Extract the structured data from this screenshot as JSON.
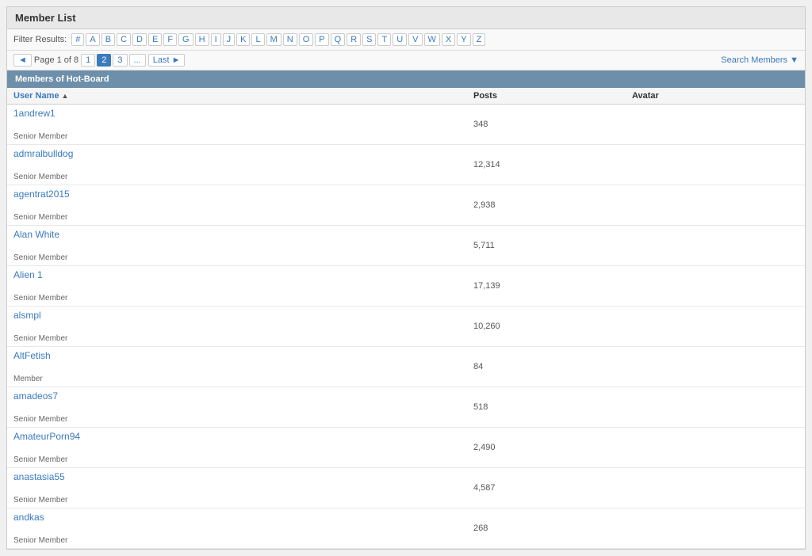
{
  "page": {
    "title": "Member List"
  },
  "filter": {
    "label": "Filter Results:",
    "letters": [
      "#",
      "A",
      "B",
      "C",
      "D",
      "E",
      "F",
      "G",
      "H",
      "I",
      "J",
      "K",
      "L",
      "M",
      "N",
      "O",
      "P",
      "Q",
      "R",
      "S",
      "T",
      "U",
      "V",
      "W",
      "X",
      "Y",
      "Z"
    ]
  },
  "pagination": {
    "info": "Page 1 of 8",
    "prev_label": "◄",
    "pages": [
      "1",
      "2",
      "3",
      "..."
    ],
    "last_label": "Last ►",
    "search_label": "Search Members ▼"
  },
  "section": {
    "header": "Members of Hot-Board"
  },
  "table": {
    "columns": {
      "username": "User Name",
      "posts": "Posts",
      "avatar": "Avatar"
    },
    "rows": [
      {
        "name": "1andrew1",
        "type": "Senior Member",
        "posts": "348",
        "avatar": ""
      },
      {
        "name": "admralbulldog",
        "type": "Senior Member",
        "posts": "12,314",
        "avatar": ""
      },
      {
        "name": "agentrat2015",
        "type": "Senior Member",
        "posts": "2,938",
        "avatar": ""
      },
      {
        "name": "Alan White",
        "type": "Senior Member",
        "posts": "5,711",
        "avatar": ""
      },
      {
        "name": "Alien 1",
        "type": "Senior Member",
        "posts": "17,139",
        "avatar": ""
      },
      {
        "name": "alsmpl",
        "type": "Senior Member",
        "posts": "10,260",
        "avatar": ""
      },
      {
        "name": "AltFetish",
        "type": "Member",
        "posts": "84",
        "avatar": ""
      },
      {
        "name": "amadeos7",
        "type": "Senior Member",
        "posts": "518",
        "avatar": ""
      },
      {
        "name": "AmateurPorn94",
        "type": "Senior Member",
        "posts": "2,490",
        "avatar": ""
      },
      {
        "name": "anastasia55",
        "type": "Senior Member",
        "posts": "4,587",
        "avatar": ""
      },
      {
        "name": "andkas",
        "type": "Senior Member",
        "posts": "268",
        "avatar": ""
      }
    ]
  }
}
